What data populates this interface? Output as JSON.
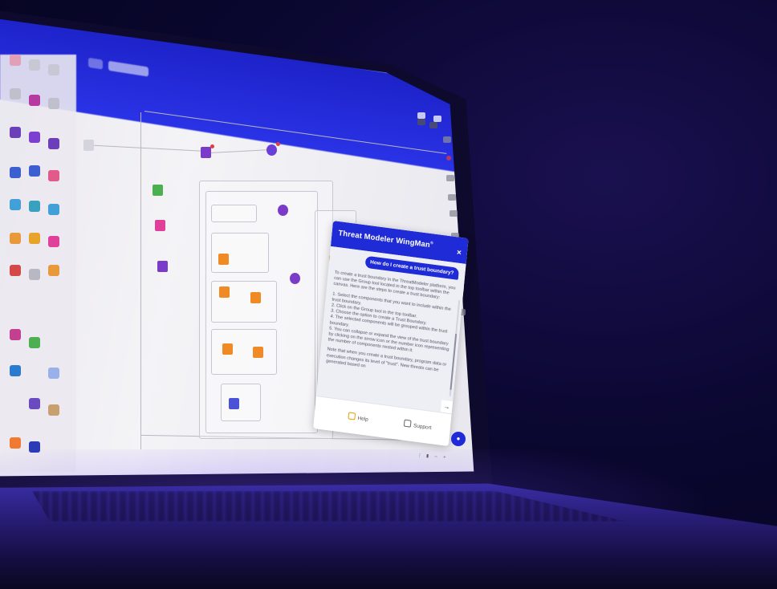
{
  "chat": {
    "title": "Threat Modeler WingMan",
    "title_mark": "®",
    "close_label": "×",
    "user_question": "How do I create a trust boundary?",
    "answer_paragraphs": [
      "To create a trust boundary in the ThreatModeler platform, you can use the Group tool located in the top toolbar within the canvas. Here are the steps to create a trust boundary:",
      "1. Select the components that you want to include within the trust boundary.\n2. Click on the Group tool in the top toolbar.\n3. Choose the option to create a Trust Boundary.\n4. The selected components will be grouped within the trust boundary.\n5. You can collapse or expand the view of the trust boundary by clicking on the arrow icon or the number icon representing the number of components nested within it.",
      "Note that when you create a trust boundary, program data or execution changes its level of \"trust\". New threats can be generated based on"
    ],
    "send_label": "→",
    "help_label": "Help",
    "support_label": "Support"
  },
  "colors": {
    "brand_blue": "#1f2bd6",
    "alert_red": "#e53b3b",
    "node_orange": "#f08a24",
    "node_purple": "#7a3cc8",
    "node_green": "#4caf50",
    "node_pink": "#e0409a"
  },
  "icons": {
    "close": "close-icon",
    "send": "arrow-right-icon",
    "help": "help-icon",
    "support": "mail-icon",
    "assistant": "user-assistant-icon"
  }
}
